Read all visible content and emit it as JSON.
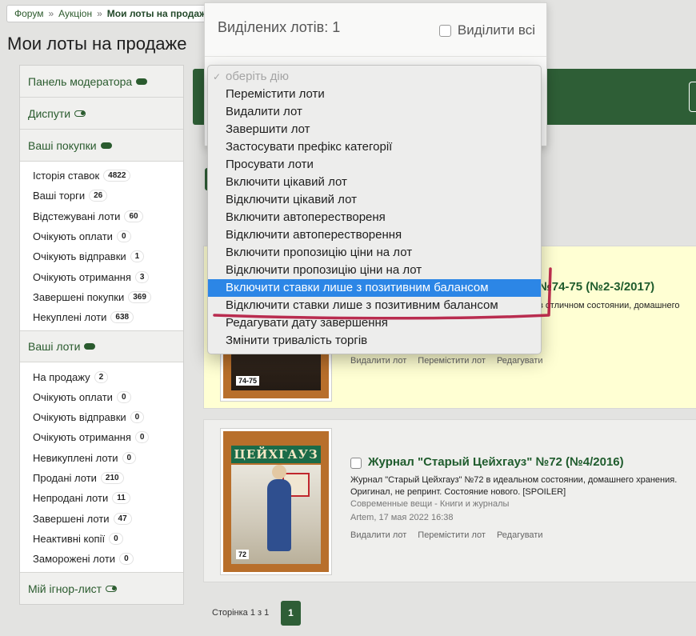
{
  "breadcrumb": {
    "items": [
      "Форум",
      "Аукціон"
    ],
    "current": "Мои лоты на продаже"
  },
  "page_title": "Мои лоты на продаже",
  "sidebar": {
    "moderator": "Панель модератора",
    "disputes": "Диспути",
    "purchases_title": "Ваші покупки",
    "purchases": [
      {
        "label": "Історія ставок",
        "count": "4822"
      },
      {
        "label": "Ваші торги",
        "count": "26"
      },
      {
        "label": "Відстежувані лоти",
        "count": "60"
      },
      {
        "label": "Очікують оплати",
        "count": "0"
      },
      {
        "label": "Очікують відправки",
        "count": "1"
      },
      {
        "label": "Очікують отримання",
        "count": "3"
      },
      {
        "label": "Завершені покупки",
        "count": "369"
      },
      {
        "label": "Некуплені лоти",
        "count": "638"
      }
    ],
    "lots_title": "Ваші лоти",
    "lots": [
      {
        "label": "На продажу",
        "count": "2"
      },
      {
        "label": "Очікують оплати",
        "count": "0"
      },
      {
        "label": "Очікують відправки",
        "count": "0"
      },
      {
        "label": "Очікують отримання",
        "count": "0"
      },
      {
        "label": "Невикуплені лоти",
        "count": "0"
      },
      {
        "label": "Продані лоти",
        "count": "210"
      },
      {
        "label": "Непродані лоти",
        "count": "11"
      },
      {
        "label": "Завершені лоти",
        "count": "47"
      },
      {
        "label": "Неактивні копії",
        "count": "0"
      },
      {
        "label": "Заморожені лоти",
        "count": "0"
      }
    ],
    "ignore": "Мій ігнор-лист"
  },
  "popup": {
    "title": "Виділених лотів: 1",
    "select_all": "Виділити всі"
  },
  "dropdown": {
    "options": [
      "оберіть дію",
      "Перемістити лоти",
      "Видалити лот",
      "Завершити лот",
      "Застосувати префікс категорії",
      "Просувати лоти",
      "Включити цікавий лот",
      "Відключити цікавий лот",
      "Включити автоперествореня",
      "Відключити автоперестворення",
      "Включити пропозицію ціни на лот",
      "Відключити пропозицію ціни на лот",
      "Включити ставки лише з позитивним балансом",
      "Відключити ставки лише з позитивним балансом",
      "Редагувати дату завершення",
      "Змінити тривалість торгів"
    ],
    "selected_index": 12
  },
  "lot1": {
    "title_tail": "№74-75 (№2-3/2017)",
    "desc_tail": "в отличном состоянии, домашнего",
    "cover_num": "74-75",
    "actions": [
      "Видалити лот",
      "Перемістити лот",
      "Редагувати"
    ]
  },
  "lot2": {
    "cover_title": "ЦЕЙХГАУЗ",
    "cover_num": "72",
    "title": "Журнал \"Старый Цейхгауз\" №72 (№4/2016)",
    "desc": "Журнал \"Старый Цейхгауз\" №72 в идеальном состоянии, домашнего хранения. Оригинал, не репринт. Состояние нового. [SPOILER]",
    "category": "Современные вещи - Книги и журналы",
    "meta": "Artem, 17 мая 2022 16:38",
    "actions": [
      "Видалити лот",
      "Перемістити лот",
      "Редагувати"
    ]
  },
  "pager": {
    "label": "Сторінка 1 з 1",
    "page": "1"
  },
  "colors": {
    "accent_green": "#2e5e36",
    "highlight_blue": "#2c86e6",
    "annotation_red": "#b3163e"
  }
}
